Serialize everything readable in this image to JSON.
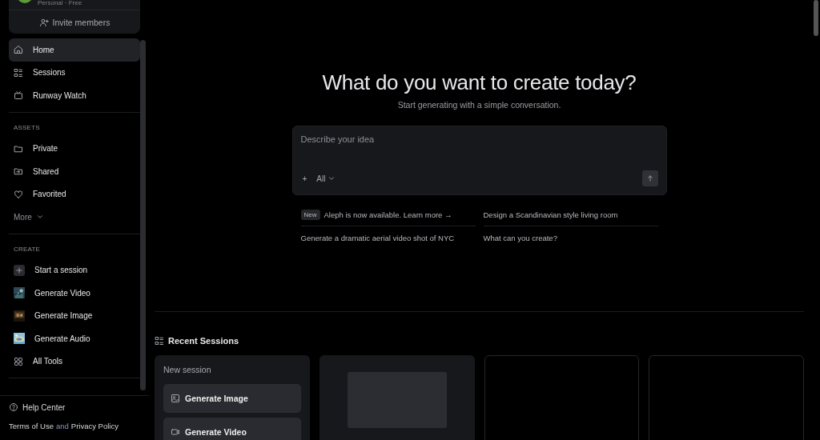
{
  "account": {
    "plan": "Personal · Free",
    "invite": "Invite members"
  },
  "sidebar": {
    "nav": [
      {
        "label": "Home",
        "selected": true
      },
      {
        "label": "Sessions",
        "selected": false
      },
      {
        "label": "Runway Watch",
        "selected": false
      }
    ],
    "sections": [
      {
        "title": "ASSETS",
        "items": [
          {
            "label": "Private",
            "kind": "icon"
          },
          {
            "label": "Shared",
            "kind": "icon"
          },
          {
            "label": "Favorited",
            "kind": "icon"
          },
          {
            "label": "More",
            "kind": "more"
          }
        ]
      },
      {
        "title": "CREATE",
        "items": [
          {
            "label": "Start a session",
            "kind": "add"
          },
          {
            "label": "Generate Video",
            "kind": "thumbnail"
          },
          {
            "label": "Generate Image",
            "kind": "thumbnail"
          },
          {
            "label": "Generate Audio",
            "kind": "thumbnail"
          },
          {
            "label": "All Tools",
            "kind": "icon"
          }
        ]
      }
    ],
    "help": "Help Center",
    "terms": "Terms of Use",
    "conjunction": "and",
    "privacy": "Privacy Policy"
  },
  "hero": {
    "title": "What do you want to create today?",
    "subtitle": "Start generating with a simple conversation."
  },
  "prompt": {
    "placeholder": "Describe your idea",
    "add": "+",
    "filter": "All"
  },
  "suggestions": [
    {
      "badge": "New",
      "text": "Aleph is now available. Learn more →"
    },
    {
      "text": "Design a Scandinavian style living room"
    },
    {
      "text": "Generate a dramatic aerial video shot of NYC"
    },
    {
      "text": "What can you create?"
    }
  ],
  "recent": {
    "title": "Recent Sessions",
    "new_session": {
      "title": "New session",
      "actions": [
        "Generate Image",
        "Generate Video"
      ]
    },
    "cards": [
      {
        "kind": "preview"
      },
      {
        "kind": "empty"
      },
      {
        "kind": "empty"
      }
    ]
  }
}
